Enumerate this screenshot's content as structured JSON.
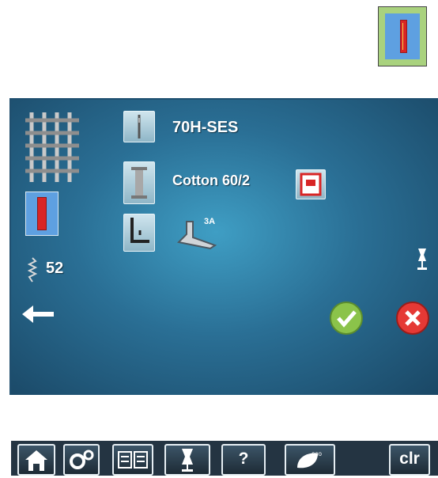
{
  "needle": {
    "label": "70H-SES"
  },
  "thread": {
    "label": "Cotton 60/2"
  },
  "presser_foot": {
    "label": "3A"
  },
  "stitch": {
    "number": "52"
  },
  "nav": {
    "clr_label": "clr",
    "help_label": "?",
    "eco_label": "eco"
  },
  "colors": {
    "screen": "#2a6f95",
    "confirm": "#8bc34a",
    "cancel": "#e53935",
    "buttonhole_red": "#d82525",
    "buttonhole_bg": "#5ea0e1"
  }
}
